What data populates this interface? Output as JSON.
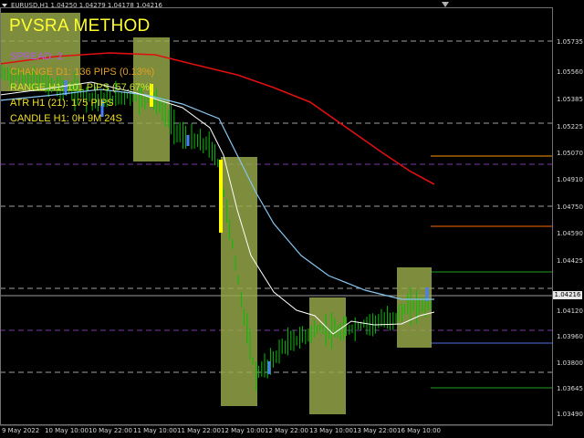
{
  "window": {
    "symbol_info": "EURUSD,H1  1.04250 1.04279 1.04178 1.04216"
  },
  "overlay": {
    "title": "PVSRA METHOD",
    "lines": [
      {
        "text": "SPREAD: 2",
        "color": "#b45ae6"
      },
      {
        "text": "CHANGE D1: 136 PIPS (0.13%)",
        "color": "#e0a020"
      },
      {
        "text": "RANGE H1: 101 PIPS (57.67%)",
        "color": "#c8e62a"
      },
      {
        "text": "ATR H1 (21): 175 PIPS",
        "color": "#f0e020"
      },
      {
        "text": "CANDLE H1: 0H 9M 24S",
        "color": "#f0e020"
      }
    ]
  },
  "price_axis": {
    "labels": [
      "1.05735",
      "1.05560",
      "1.05385",
      "1.05225",
      "1.05070",
      "1.04910",
      "1.04750",
      "1.04590",
      "1.04425",
      "1.04120",
      "1.03960",
      "1.03800",
      "1.03645",
      "1.03490"
    ],
    "current": "1.04216"
  },
  "time_axis": {
    "labels": [
      "9 May 2022",
      "10 May 10:00",
      "10 May 22:00",
      "11 May 10:00",
      "11 May 22:00",
      "12 May 10:00",
      "12 May 22:00",
      "13 May 10:00",
      "13 May 22:00",
      "16 May 10:00"
    ]
  },
  "colors": {
    "background": "#000000",
    "up_candle": "#00c000",
    "down_candle": "#00c000",
    "climax_candle": "#ffff00",
    "volume_box": "#9aab4a",
    "ma_slow": "#e01010",
    "ma_fast": "#87c5ee",
    "ma_close": "#ffffff",
    "level_grey": "#a0a0a0",
    "level_purple": "#7a3aa0",
    "level_orange_1": "#ff9a00",
    "level_orange_2": "#ff6a00",
    "level_green": "#1f9f1f",
    "level_blue": "#5070e0"
  }
}
